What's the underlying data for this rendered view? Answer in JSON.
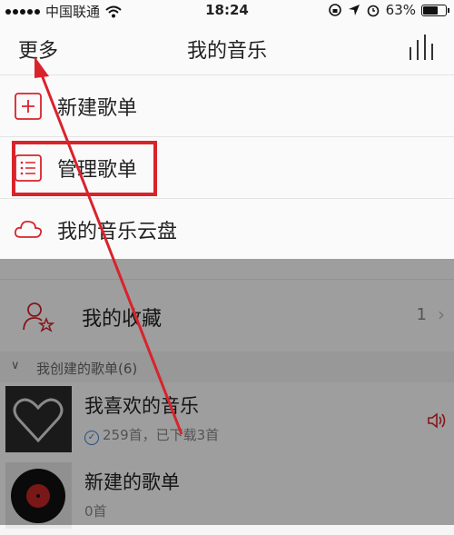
{
  "status": {
    "carrier": "中国联通",
    "time": "18:24",
    "battery_text": "63%",
    "battery_level": 0.63
  },
  "header": {
    "more": "更多",
    "title": "我的音乐"
  },
  "menu": [
    {
      "label": "新建歌单",
      "icon": "plus-square-icon"
    },
    {
      "label": "管理歌单",
      "icon": "list-icon"
    },
    {
      "label": "我的音乐云盘",
      "icon": "cloud-icon"
    }
  ],
  "favorites": {
    "label": "我的收藏",
    "count": "1"
  },
  "section": {
    "label": "我创建的歌单(6)"
  },
  "playlists": [
    {
      "name": "我喜欢的音乐",
      "sub": "259首，已下载3首"
    },
    {
      "name": "新建的歌单",
      "sub": "0首"
    }
  ],
  "colors": {
    "accent": "#d9232b"
  }
}
